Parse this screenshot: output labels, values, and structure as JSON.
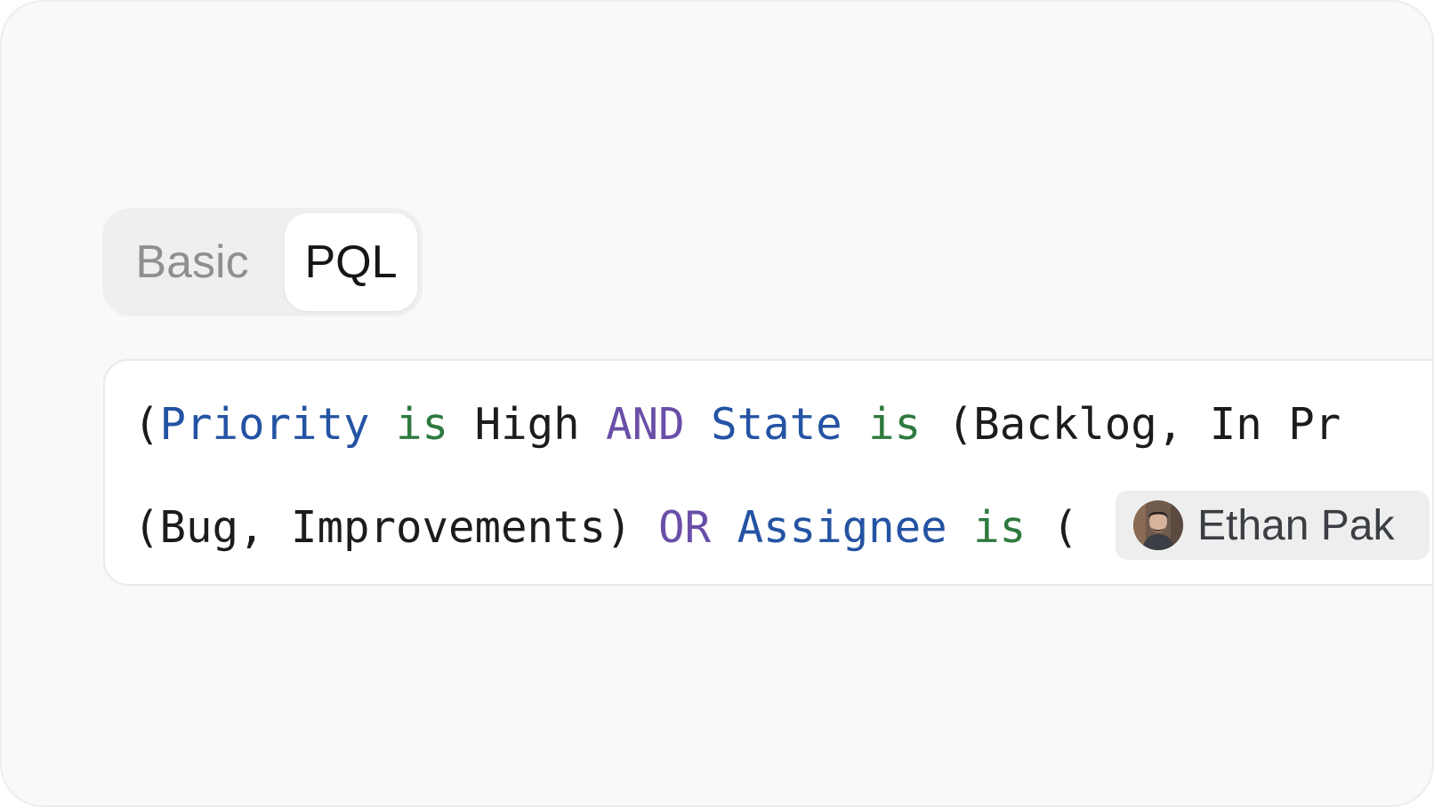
{
  "mode_toggle": {
    "tabs": [
      {
        "label": "Basic",
        "selected": false
      },
      {
        "label": "PQL",
        "selected": true
      }
    ]
  },
  "query": {
    "line1": {
      "open_paren": "(",
      "field1": "Priority",
      "op1": "is",
      "value1": "High",
      "logic1": "AND",
      "field2": "State",
      "op2": "is",
      "value2": "(Backlog, In Pr"
    },
    "line2": {
      "value3": "(Bug, Improvements)",
      "logic2": "OR",
      "field3": "Assignee",
      "op3": "is",
      "open_paren": "(",
      "chip_name": "Ethan Pak",
      "chip_icon": "avatar-photo"
    }
  },
  "colors": {
    "field": "#2453a3",
    "operator": "#2d7a3e",
    "logic": "#6a4fa8",
    "value": "#1c1c1c",
    "card_background": "#f8f9f9"
  }
}
